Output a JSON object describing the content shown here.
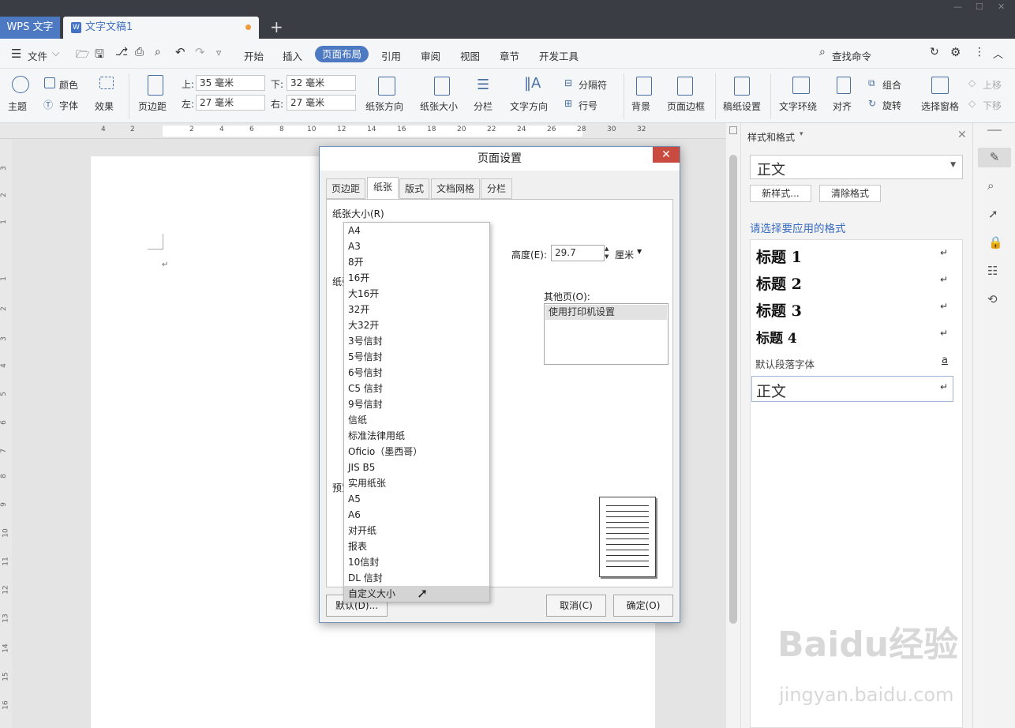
{
  "titlebar": {
    "app_tab": "WPS 文字",
    "doc_tab": "文字文稿1",
    "doc_icon": "W",
    "add_tab": "+"
  },
  "menubar": {
    "file": "文件",
    "tabs": [
      "开始",
      "插入",
      "页面布局",
      "引用",
      "审阅",
      "视图",
      "章节",
      "开发工具"
    ],
    "active_tab": "页面布局",
    "search": "查找命令"
  },
  "ribbon": {
    "theme": "主题",
    "color": "颜色",
    "font": "字体",
    "effect": "效果",
    "margins": "页边距",
    "top_label": "上:",
    "top_value": "35 毫米",
    "bottom_label": "下:",
    "bottom_value": "32 毫米",
    "left_label": "左:",
    "left_value": "27 毫米",
    "right_label": "右:",
    "right_value": "27 毫米",
    "orientation": "纸张方向",
    "size": "纸张大小",
    "columns": "分栏",
    "text_direction": "文字方向",
    "separator": "分隔符",
    "line_number": "行号",
    "background": "背景",
    "page_border": "页面边框",
    "manuscript": "稿纸设置",
    "wrap": "文字环绕",
    "align": "对齐",
    "group": "组合",
    "rotate": "旋转",
    "selection_pane": "选择窗格",
    "move_up": "上移",
    "move_down": "下移"
  },
  "ruler": {
    "numbers": [
      "4",
      "2",
      "2",
      "4",
      "6",
      "8",
      "10",
      "12",
      "14",
      "16",
      "18",
      "20",
      "22",
      "24",
      "26",
      "28",
      "30",
      "32"
    ]
  },
  "vruler": {
    "numbers": [
      "3",
      "2",
      "1",
      "1",
      "2",
      "3",
      "4",
      "5",
      "6",
      "7",
      "8",
      "9",
      "10",
      "11",
      "12",
      "13",
      "14",
      "15",
      "16"
    ]
  },
  "panel": {
    "title": "样式和格式",
    "current_style": "正文",
    "new_style": "新样式...",
    "clear_format": "清除格式",
    "prompt": "请选择要应用的格式",
    "styles": [
      "标题 1",
      "标题 2",
      "标题 3",
      "标题 4"
    ],
    "default_font": "默认段落字体",
    "default_font_mark": "a",
    "body_style": "正文",
    "return_mark": "↵"
  },
  "dialog": {
    "title": "页面设置",
    "tabs": [
      "页边距",
      "纸张",
      "版式",
      "文档网格",
      "分栏"
    ],
    "active_tab": "纸张",
    "paper_size_label": "纸张大小(R)",
    "paper_source_label": "纸张",
    "preview_label": "预览",
    "height_label": "高度(E):",
    "height_value": "29.7",
    "unit": "厘米",
    "other_pages_label": "其他页(O):",
    "other_pages_value": "使用打印机设置",
    "default_btn": "默认(D)...",
    "cancel_btn": "取消(C)",
    "ok_btn": "确定(O)"
  },
  "dropdown": {
    "options": [
      "A4",
      "A3",
      "8开",
      "16开",
      "大16开",
      "32开",
      "大32开",
      "3号信封",
      "5号信封",
      "6号信封",
      "C5 信封",
      "9号信封",
      "信纸",
      "标准法律用纸",
      "Oficio（墨西哥）",
      "JIS B5",
      "实用纸张",
      "A5",
      "A6",
      "对开纸",
      "报表",
      "10信封",
      "DL 信封",
      "自定义大小"
    ],
    "selected": "自定义大小"
  },
  "watermark": {
    "text": "Baidu经验",
    "url": "jingyan.baidu.com"
  }
}
